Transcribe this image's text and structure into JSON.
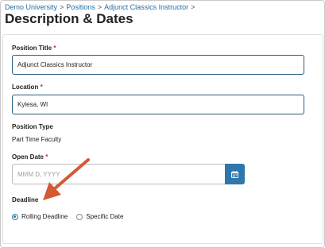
{
  "breadcrumb": {
    "items": [
      "Demo University",
      "Positions",
      "Adjunct Classics Instructor"
    ],
    "separator": ">"
  },
  "page": {
    "title": "Description & Dates"
  },
  "form": {
    "position_title": {
      "label": "Position Title",
      "required_mark": "*",
      "value": "Adjunct Classics Instructor"
    },
    "location": {
      "label": "Location",
      "required_mark": "*",
      "value": "Kylesa, WI"
    },
    "position_type": {
      "label": "Position Type",
      "value": "Part Time Faculty"
    },
    "open_date": {
      "label": "Open Date",
      "required_mark": "*",
      "placeholder": "MMM D, YYYY",
      "value": ""
    },
    "deadline": {
      "label": "Deadline",
      "options": [
        "Rolling Deadline",
        "Specific Date"
      ],
      "selected": "Rolling Deadline"
    }
  },
  "colors": {
    "accent": "#2e77ad",
    "link": "#1d6fa5",
    "required": "#c62828",
    "annotation_arrow": "#d35a35"
  },
  "icons": {
    "calendar": "calendar-icon",
    "annotation": "annotation-arrow-icon"
  }
}
